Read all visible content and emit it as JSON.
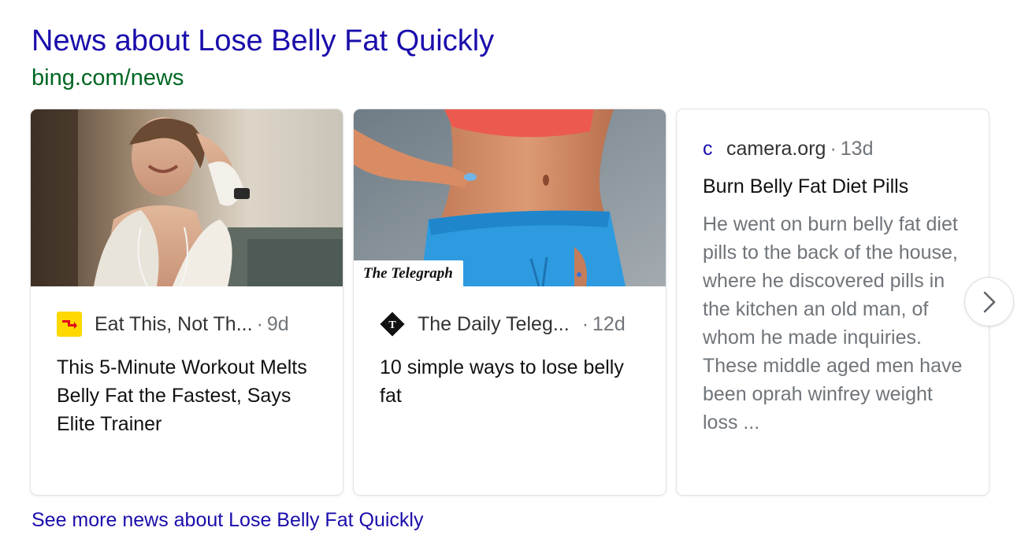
{
  "header": {
    "title": "News about Lose Belly Fat Quickly",
    "url": "bing.com/news"
  },
  "cards": [
    {
      "image": "woman-with-towel-after-workout",
      "source_icon": "eat-this-logo-icon",
      "source": "Eat This, Not Th...",
      "separator": "·",
      "age": "9d",
      "headline": "This 5-Minute Workout Melts Belly Fat the Fastest, Says Elite Trainer"
    },
    {
      "image": "woman-pinching-belly",
      "image_badge": "The Telegraph",
      "source_icon": "telegraph-logo-icon",
      "source": "The Daily Teleg...",
      "separator": "·",
      "age": "12d",
      "headline": "10 simple ways to lose belly fat"
    },
    {
      "source_icon": "c",
      "source": "camera.org",
      "separator": "·",
      "age": "13d",
      "headline": "Burn Belly Fat Diet Pills",
      "snippet": "He went on burn belly fat diet pills to the back of the house, where he discovered pills in the kitchen an old man, of whom he made inquiries. These middle aged men have been oprah winfrey weight loss ..."
    }
  ],
  "next_button_icon": "chevron-right-icon",
  "footer": {
    "more_link": "See more news about Lose Belly Fat Quickly"
  },
  "colors": {
    "link": "#1a0dab",
    "url_green": "#006621",
    "meta_gray": "#70757a",
    "eat_this_yellow": "#ffd800",
    "eat_this_red": "#e3001b"
  }
}
